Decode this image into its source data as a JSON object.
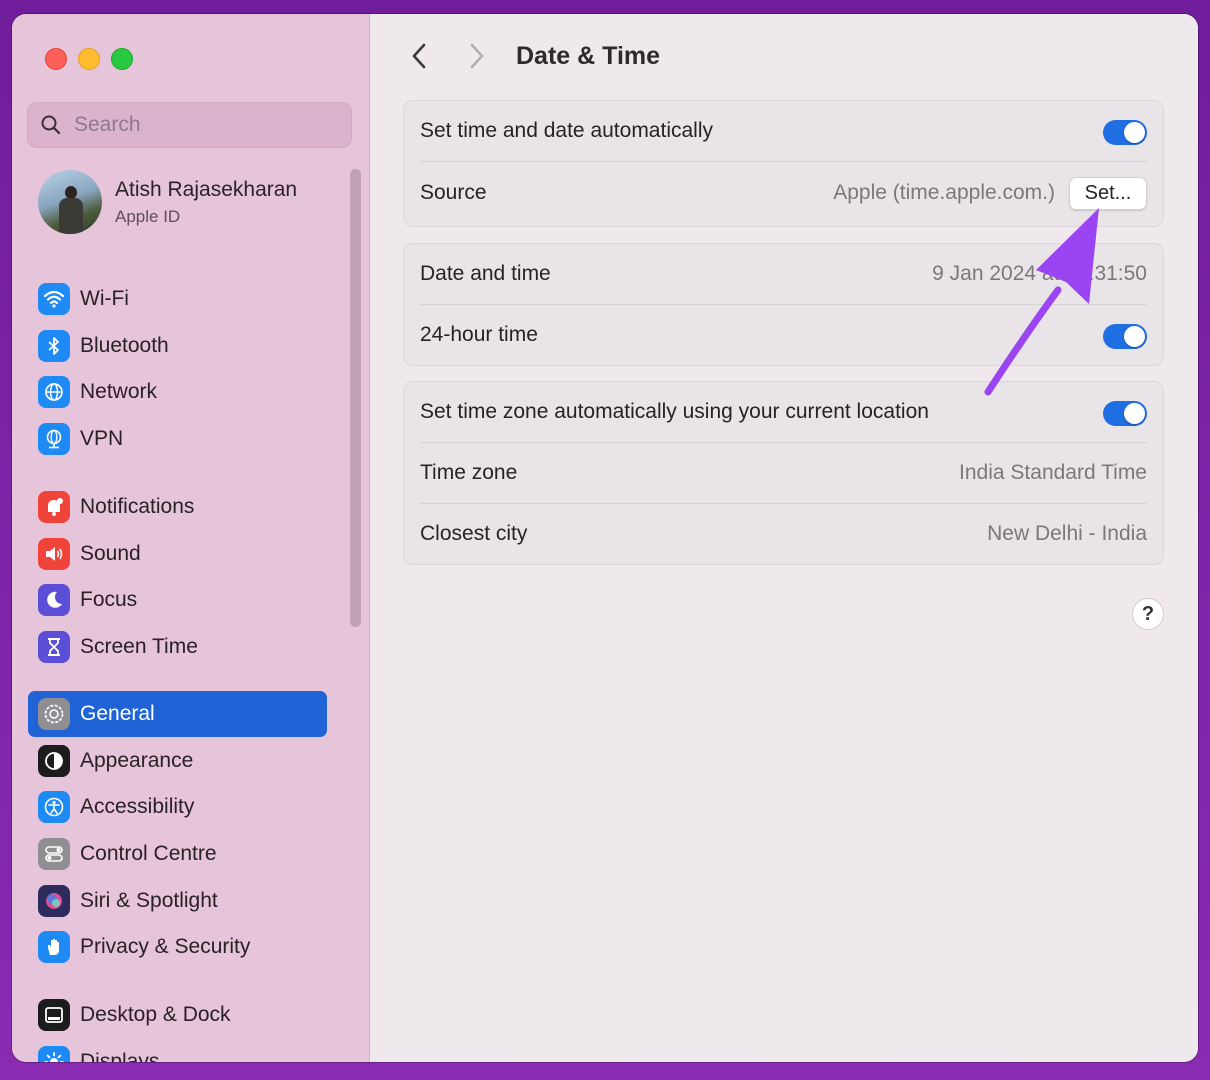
{
  "window": {
    "title": "Date & Time"
  },
  "search": {
    "placeholder": "Search"
  },
  "profile": {
    "name": "Atish Rajasekharan",
    "subtitle": "Apple ID"
  },
  "sidebar": {
    "items": [
      {
        "label": "Wi-Fi",
        "icon": "wifi-icon",
        "color": "#1e8bf5"
      },
      {
        "label": "Bluetooth",
        "icon": "bluetooth-icon",
        "color": "#1e8bf5"
      },
      {
        "label": "Network",
        "icon": "globe-icon",
        "color": "#1e8bf5"
      },
      {
        "label": "VPN",
        "icon": "vpn-globe-icon",
        "color": "#1e8bf5"
      },
      {
        "label": "Notifications",
        "icon": "bell-icon",
        "color": "#f0433a"
      },
      {
        "label": "Sound",
        "icon": "speaker-icon",
        "color": "#f0433a"
      },
      {
        "label": "Focus",
        "icon": "moon-icon",
        "color": "#5a4fd6"
      },
      {
        "label": "Screen Time",
        "icon": "hourglass-icon",
        "color": "#5a4fd6"
      },
      {
        "label": "General",
        "icon": "gear-icon",
        "color": "#8e8e93",
        "active": true
      },
      {
        "label": "Appearance",
        "icon": "appearance-icon",
        "color": "#1c1c1e"
      },
      {
        "label": "Accessibility",
        "icon": "accessibility-icon",
        "color": "#1e8bf5"
      },
      {
        "label": "Control Centre",
        "icon": "control-centre-icon",
        "color": "#8e8e93"
      },
      {
        "label": "Siri & Spotlight",
        "icon": "siri-icon",
        "color": "#2b2b5e"
      },
      {
        "label": "Privacy & Security",
        "icon": "hand-icon",
        "color": "#1e8bf5"
      },
      {
        "label": "Desktop & Dock",
        "icon": "dock-icon",
        "color": "#1c1c1e"
      },
      {
        "label": "Displays",
        "icon": "sun-icon",
        "color": "#1e8bf5"
      }
    ]
  },
  "main": {
    "group1": {
      "auto_label": "Set time and date automatically",
      "auto_on": true,
      "source_label": "Source",
      "source_value": "Apple (time.apple.com.)",
      "set_button": "Set..."
    },
    "group2": {
      "datetime_label": "Date and time",
      "datetime_value": "9 Jan 2024 at 18:31:50",
      "hour24_label": "24-hour time",
      "hour24_on": true
    },
    "group3": {
      "tz_auto_label": "Set time zone automatically using your current location",
      "tz_auto_on": true,
      "tz_label": "Time zone",
      "tz_value": "India Standard Time",
      "city_label": "Closest city",
      "city_value": "New Delhi - India"
    },
    "help": "?"
  },
  "colors": {
    "accent": "#1f63d6",
    "sidebar": "#e6c4da",
    "annotation_arrow": "#9b45f2"
  }
}
